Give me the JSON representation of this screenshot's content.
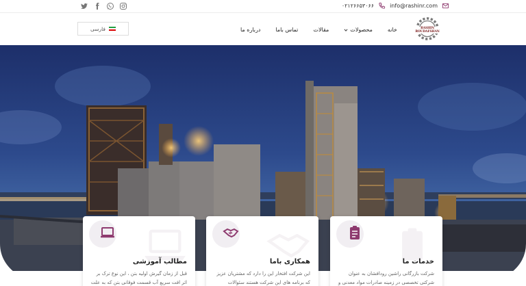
{
  "topbar": {
    "email": "info@rashinr.com",
    "phone": "۰۲۱۲۶۶۵۳۰۶۶",
    "social_icons": [
      "twitter-icon",
      "facebook-icon",
      "whatsapp-icon",
      "instagram-icon"
    ]
  },
  "header": {
    "logo_text": "RASHIN ROUDAFSHAN",
    "language": "فارسی",
    "nav": [
      {
        "label": "خانه"
      },
      {
        "label": "محصولات"
      },
      {
        "label": "مقالات"
      },
      {
        "label": "تماس باما"
      },
      {
        "label": "درباره ما"
      }
    ]
  },
  "cards": [
    {
      "title": "مطالب آموزشی",
      "text": "قبل از زمان گیرش اولیه بتن ، این نوع ترک بر اثر افت سریع آب قسمت فوقانی بتن که به علت"
    },
    {
      "title": "همکاری باما",
      "text": "این شرکت افتخار این را دارد که مشتریان عزیز که برنامه های این شرکت هستند سئوالات تخصصی"
    },
    {
      "title": "خدمات ما",
      "text": "شرکت بازرگانی راشین رودافشان به عنوان شرکتی تخصصی در زمینه صادرات مواد معدنی و انواع"
    }
  ],
  "colors": {
    "accent": "#8e3a6f",
    "icon_grey": "#6f6f6f",
    "card_blob": "#f1eef2"
  }
}
